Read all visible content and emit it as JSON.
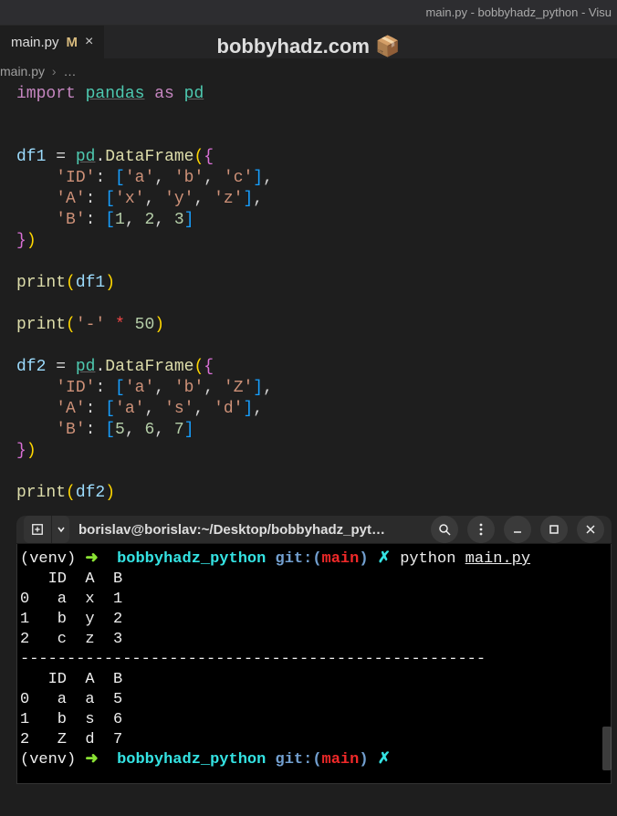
{
  "window": {
    "title": "main.py - bobbyhadz_python - Visu"
  },
  "watermark": {
    "text": "bobbyhadz.com 📦"
  },
  "tab": {
    "filename": "main.py",
    "dirty_indicator": "M",
    "close": "×"
  },
  "breadcrumb": {
    "file": "main.py",
    "sep": "›",
    "dots": "…"
  },
  "code": {
    "l1": {
      "import": "import",
      "pandas": "pandas",
      "as": "as",
      "pd": "pd"
    },
    "l3": {
      "var": "df1",
      "eq": "=",
      "pd": "pd",
      "dot": ".",
      "fn": "DataFrame",
      "open": "({"
    },
    "l4": {
      "key": "'ID'",
      "vals": "['a', 'b', 'c']"
    },
    "l4a": "'a'",
    "l4b": "'b'",
    "l4c": "'c'",
    "l5": {
      "key": "'A'"
    },
    "l5a": "'x'",
    "l5b": "'y'",
    "l5c": "'z'",
    "l6": {
      "key": "'B'"
    },
    "l6a": "1",
    "l6b": "2",
    "l6c": "3",
    "l7": {
      "close": "})"
    },
    "l9": {
      "fn": "print",
      "arg": "df1"
    },
    "l11": {
      "fn": "print",
      "dash": "'-'",
      "star": "*",
      "fifty": "50"
    },
    "l13": {
      "var": "df2",
      "eq": "=",
      "pd": "pd",
      "dot": ".",
      "fn": "DataFrame",
      "open": "({"
    },
    "l14": {
      "key": "'ID'"
    },
    "l14a": "'a'",
    "l14b": "'b'",
    "l14c": "'Z'",
    "l15": {
      "key": "'A'"
    },
    "l15a": "'a'",
    "l15b": "'s'",
    "l15c": "'d'",
    "l16": {
      "key": "'B'"
    },
    "l16a": "5",
    "l16b": "6",
    "l16c": "7",
    "l17": {
      "close": "})"
    },
    "l19": {
      "fn": "print",
      "arg": "df2"
    }
  },
  "terminal": {
    "header_title": "borislav@borislav:~/Desktop/bobbyhadz_pyt…",
    "prompt": {
      "venv": "(venv)",
      "arrow": "➜",
      "dir": "bobbyhadz_python",
      "git": "git:(",
      "branch": "main",
      "git_close": ")",
      "dirty": "✗",
      "cmd_python": "python",
      "cmd_file": "main.py"
    },
    "out": [
      "   ID  A  B",
      "0   a  x  1",
      "1   b  y  2",
      "2   c  z  3",
      "--------------------------------------------------",
      "   ID  A  B",
      "0   a  a  5",
      "1   b  s  6",
      "2   Z  d  7"
    ]
  }
}
